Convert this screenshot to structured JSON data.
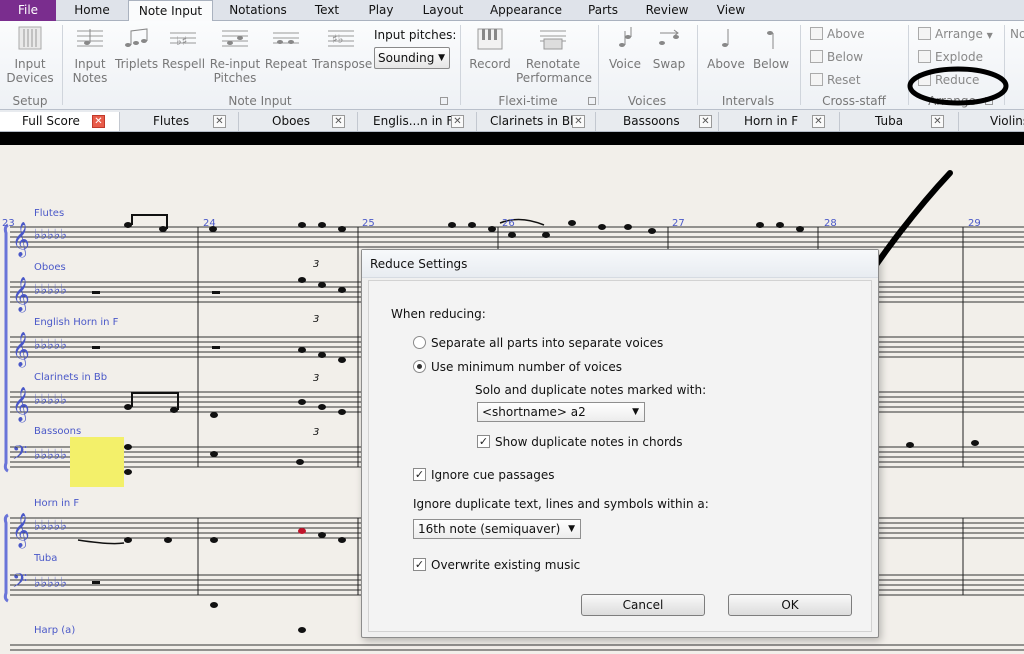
{
  "ribbon_tabs": [
    "File",
    "Home",
    "Note Input",
    "Notations",
    "Text",
    "Play",
    "Layout",
    "Appearance",
    "Parts",
    "Review",
    "View"
  ],
  "ribbon": {
    "input_devices": "Input Devices",
    "setup_group": "Setup",
    "input_notes": "Input Notes",
    "triplets": "Triplets",
    "respell": "Respell",
    "reinput_pitches": "Re-input Pitches",
    "repeat": "Repeat",
    "transpose": "Transpose",
    "input_pitches_label": "Input pitches:",
    "input_pitches_value": "Sounding",
    "note_input_group": "Note Input",
    "record": "Record",
    "renotate": "Renotate Performance",
    "flexi_group": "Flexi-time",
    "voice": "Voice",
    "swap": "Swap",
    "voices_group": "Voices",
    "above": "Above",
    "below": "Below",
    "intervals_group": "Intervals",
    "cs_above": "Above",
    "cs_below": "Below",
    "cs_reset": "Reset",
    "cross_staff_group": "Cross-staff Notes",
    "arrange": "Arrange",
    "explode": "Explode",
    "reduce": "Reduce",
    "arrange_group": "Arrange",
    "cut_text": "No"
  },
  "part_tabs": [
    "Full Score",
    "Flutes",
    "Oboes",
    "Englis...n in F",
    "Clarinets in Bb",
    "Bassoons",
    "Horn in F",
    "Tuba",
    "Violins"
  ],
  "score": {
    "instruments": [
      "Flutes",
      "Oboes",
      "English Horn in F",
      "Clarinets in Bb",
      "Bassoons",
      "Horn in F",
      "Tuba",
      "Harp (a)"
    ],
    "bar_numbers": [
      "23",
      "24",
      "25",
      "26",
      "27",
      "28",
      "29"
    ],
    "triplet_label": "3"
  },
  "dialog": {
    "title": "Reduce Settings",
    "when_reducing": "When reducing:",
    "opt_separate": "Separate all parts into separate voices",
    "opt_minimum": "Use minimum number of voices",
    "selected_option": "minimum",
    "solo_label": "Solo and duplicate notes marked with:",
    "solo_value": "<shortname> a2",
    "show_duplicates": "Show duplicate notes in chords",
    "ignore_cue": "Ignore cue passages",
    "ignore_dup_label": "Ignore duplicate text, lines and symbols within a:",
    "ignore_dup_value": "16th note (semiquaver)",
    "overwrite": "Overwrite existing music",
    "cancel": "Cancel",
    "ok": "OK"
  },
  "colors": {
    "file_tab": "#7a2d8e",
    "score_blue": "#4a58c8",
    "highlight": "#f3f06a"
  }
}
